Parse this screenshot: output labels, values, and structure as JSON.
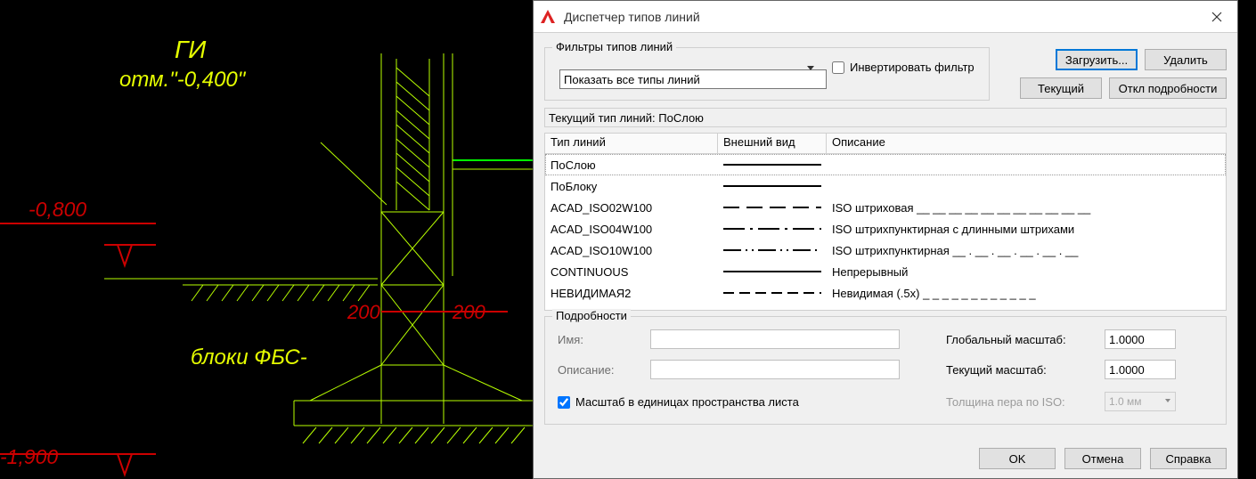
{
  "cad": {
    "text_gi": "ГИ",
    "text_mark1": "отм.\"-0,400\"",
    "text_level_08": "-0,800",
    "text_level_19": "-1,900",
    "text_dim_200a": "200",
    "text_dim_200b": "200",
    "text_fbs": "блоки ФБС-"
  },
  "dialog": {
    "title": "Диспетчер типов линий",
    "filters_group": "Фильтры типов линий",
    "filter_value": "Показать все типы линий",
    "invert_label": "Инвертировать фильтр",
    "btn_load": "Загрузить...",
    "btn_delete": "Удалить",
    "btn_current": "Текущий",
    "btn_details": "Откл подробности",
    "current_label": "Текущий тип линий:  ПоСлою",
    "col_name": "Тип линий",
    "col_appearance": "Внешний вид",
    "col_desc": "Описание",
    "rows": [
      {
        "name": "ПоСлою",
        "desc": "",
        "pat": "solid",
        "sel": true
      },
      {
        "name": "ПоБлоку",
        "desc": "",
        "pat": "solid"
      },
      {
        "name": "ACAD_ISO02W100",
        "desc": "ISO штриховая __ __ __ __ __ __ __ __ __ __ __",
        "pat": "dash"
      },
      {
        "name": "ACAD_ISO04W100",
        "desc": "ISO штрихпунктирная с длинными штрихами",
        "pat": "dashdot"
      },
      {
        "name": "ACAD_ISO10W100",
        "desc": "ISO штрихпунктирная __ . __ . __ . __ . __ . __",
        "pat": "dashdot2"
      },
      {
        "name": "CONTINUOUS",
        "desc": "Непрерывный",
        "pat": "solid"
      },
      {
        "name": "НЕВИДИМАЯ2",
        "desc": "Невидимая (.5x) _ _ _ _ _ _ _ _ _ _ _ _",
        "pat": "shortdash"
      }
    ],
    "details_group": "Подробности",
    "lbl_name": "Имя:",
    "lbl_desc": "Описание:",
    "chk_paper": "Масштаб в единицах пространства листа",
    "lbl_global": "Глобальный масштаб:",
    "lbl_curscale": "Текущий масштаб:",
    "lbl_iso": "Толщина пера по ISO:",
    "val_global": "1.0000",
    "val_curscale": "1.0000",
    "val_iso": "1.0 мм",
    "btn_ok": "OK",
    "btn_cancel": "Отмена",
    "btn_help": "Справка"
  }
}
